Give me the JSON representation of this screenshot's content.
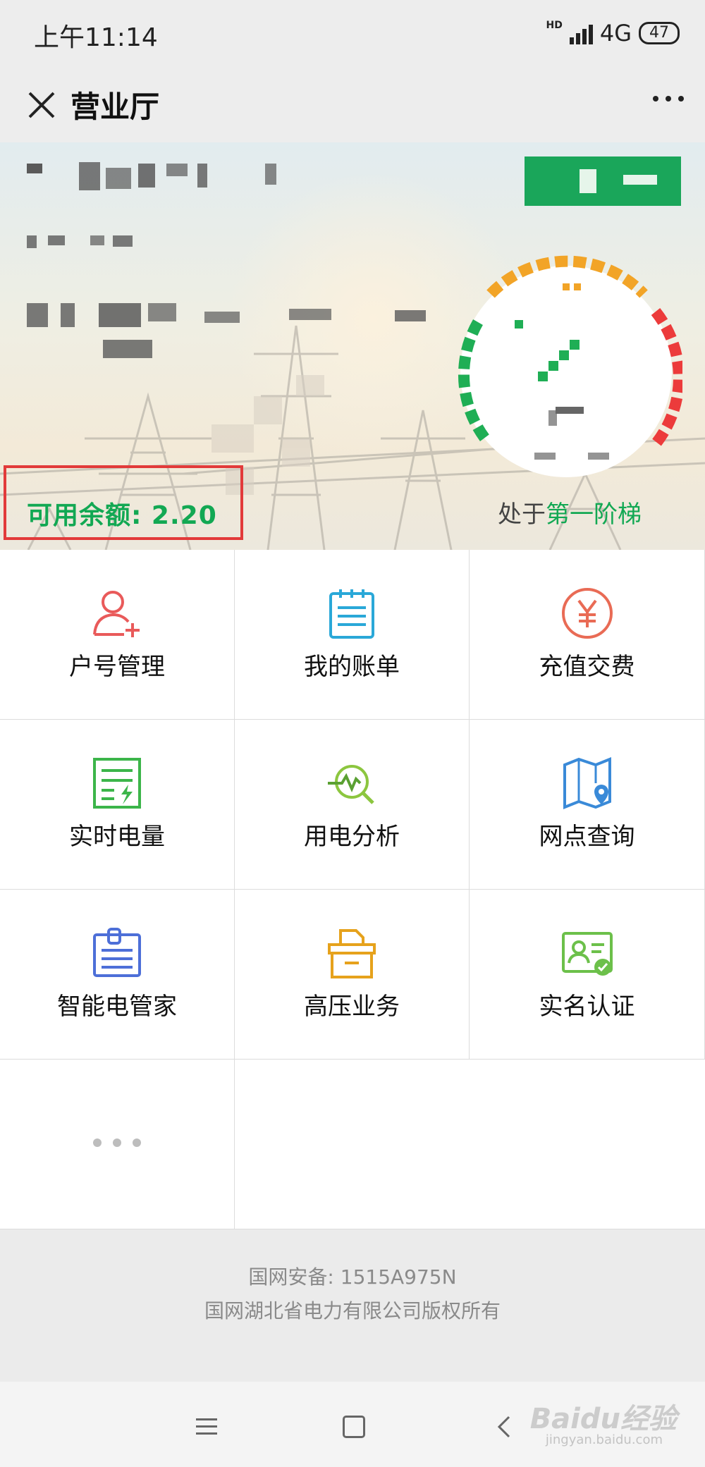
{
  "status_bar": {
    "time": "上午11:14",
    "network": "4G",
    "hd": "HD",
    "battery": "47"
  },
  "nav": {
    "title": "营业厅"
  },
  "banner": {
    "balance": "可用余额: 2.20",
    "tier_prefix": "处于",
    "tier_value": "第一阶梯"
  },
  "menu": [
    {
      "label": "户号管理",
      "icon": "user-add-icon",
      "color": "#e95a5a"
    },
    {
      "label": "我的账单",
      "icon": "bill-icon",
      "color": "#2aa8d8"
    },
    {
      "label": "充值交费",
      "icon": "yuan-icon",
      "color": "#e96b55"
    },
    {
      "label": "实时电量",
      "icon": "realtime-power-icon",
      "color": "#3cb54a"
    },
    {
      "label": "用电分析",
      "icon": "analysis-icon",
      "color": "#8cc63f"
    },
    {
      "label": "网点查询",
      "icon": "map-pin-icon",
      "color": "#3a8ad8"
    },
    {
      "label": "智能电管家",
      "icon": "clipboard-icon",
      "color": "#4d6fd8"
    },
    {
      "label": "高压业务",
      "icon": "folder-box-icon",
      "color": "#e6a21c"
    },
    {
      "label": "实名认证",
      "icon": "id-card-icon",
      "color": "#6cc04a"
    }
  ],
  "footer": {
    "line1": "国网安备: 1515A975N",
    "line2": "国网湖北省电力有限公司版权所有"
  },
  "watermark": {
    "main": "Baidu经验",
    "sub": "jingyan.baidu.com"
  }
}
